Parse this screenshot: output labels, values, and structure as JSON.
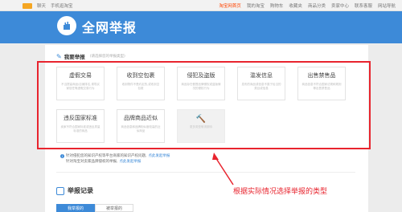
{
  "topbar": {
    "left_items": [
      "聊天",
      "手机逛淘宝"
    ],
    "right_items": [
      "淘宝网首页",
      "我的淘宝",
      "购物车",
      "收藏夹",
      "商品分类",
      "卖家中心",
      "联系客服",
      "网站导航"
    ]
  },
  "header": {
    "title": "全网举报",
    "logo_icon": "fist-icon"
  },
  "section": {
    "title": "我要举报",
    "note": "(请选择您的举报类型)"
  },
  "cards": [
    {
      "title": "虚假交易",
      "desc": "不当提高商品/店铺排名,诱导买家信任等虚假交易行为"
    },
    {
      "title": "收到空包裹",
      "desc": "收到物件不是约定的,或收到空包裹"
    },
    {
      "title": "侵犯及盗版",
      "desc": "商品存在假冒品牌侵权或盗版情况的侵权行为"
    },
    {
      "title": "滥发信息",
      "desc": "发布的商品或信息不属于恰当的类目或信息"
    },
    {
      "title": "出售禁售品",
      "desc": "商品信息不符合国家法规和规则等出售禁售品"
    },
    {
      "title": "违反国家标准",
      "desc": "卖家不符合国家标准或违反质量标准的商品"
    },
    {
      "title": "品牌商品近似",
      "desc": "商品信息和品牌相似度较高的近似商品"
    },
    {
      "title": "更多举报类型",
      "desc": "更多类型敬请期待",
      "disabled": true
    }
  ],
  "notice": {
    "line1": "针对侵犯您的知识产权等平台商家的知识产权问题,",
    "line1_link": "点此发起举报",
    "line2": "针对淘宝对卖家品牌侵权的举报,",
    "line2_link": "点此发起举报"
  },
  "record": {
    "title": "举报记录"
  },
  "tabs": [
    "我举报的",
    "被举报的"
  ],
  "annotation": "根据实际情况选择举报的类型",
  "colors": {
    "accent": "#3d8ad8",
    "highlight": "#e8242e"
  }
}
